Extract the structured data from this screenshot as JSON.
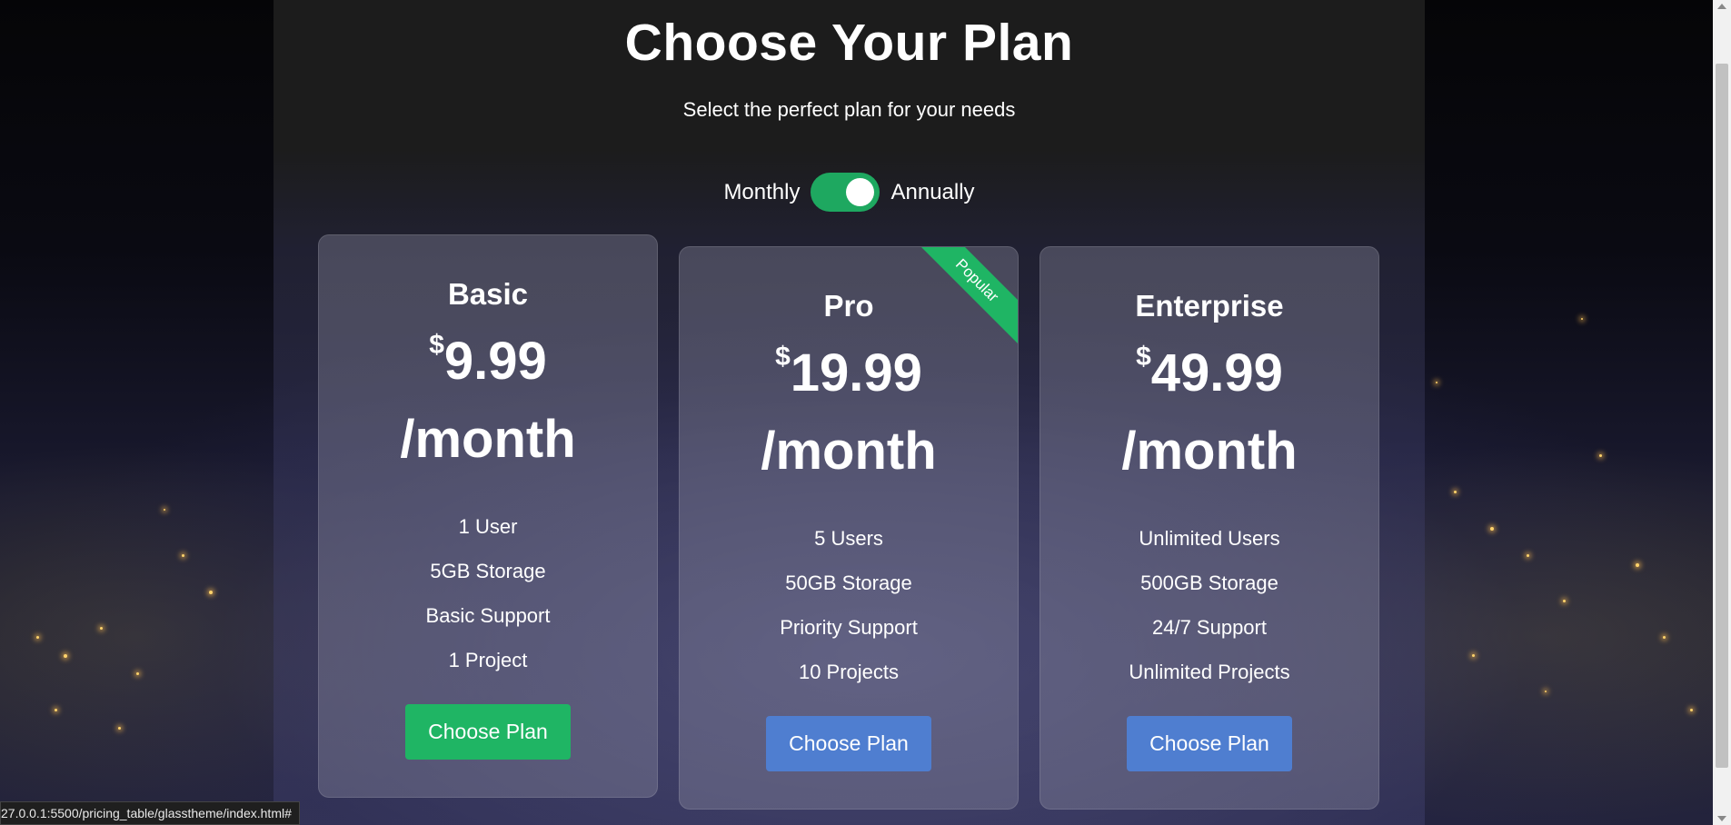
{
  "header": {
    "title": "Choose Your Plan",
    "subtitle": "Select the perfect plan for your needs"
  },
  "billing_toggle": {
    "left_label": "Monthly",
    "right_label": "Annually",
    "state": "on",
    "color": "#1ea860"
  },
  "plans": [
    {
      "name": "Basic",
      "currency": "$",
      "price": "9.99",
      "period": "/month",
      "features": [
        "1 User",
        "5GB Storage",
        "Basic Support",
        "1 Project"
      ],
      "button_label": "Choose Plan",
      "button_color": "#1fb564"
    },
    {
      "name": "Pro",
      "currency": "$",
      "price": "19.99",
      "period": "/month",
      "badge": "Popular",
      "features": [
        "5 Users",
        "50GB Storage",
        "Priority Support",
        "10 Projects"
      ],
      "button_label": "Choose Plan",
      "button_color": "#4f7ed0"
    },
    {
      "name": "Enterprise",
      "currency": "$",
      "price": "49.99",
      "period": "/month",
      "features": [
        "Unlimited Users",
        "500GB Storage",
        "24/7 Support",
        "Unlimited Projects"
      ],
      "button_label": "Choose Plan",
      "button_color": "#4f7ed0"
    }
  ],
  "status_bar": {
    "url": "27.0.0.1:5500/pricing_table/glasstheme/index.html#"
  }
}
